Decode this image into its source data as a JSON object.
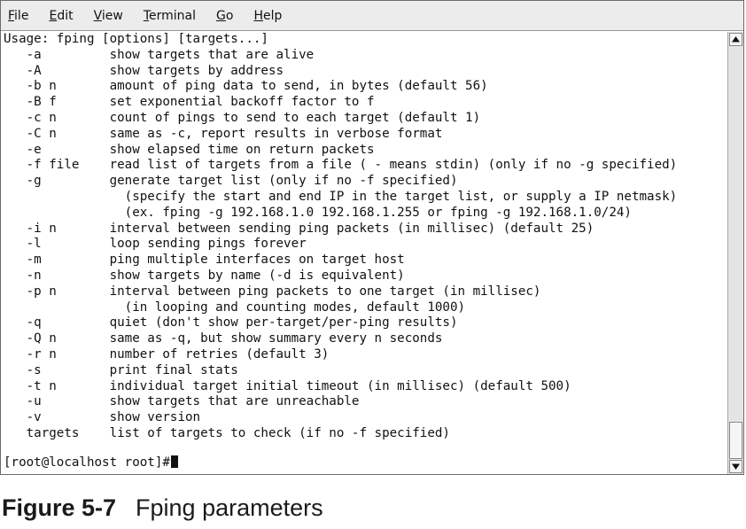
{
  "menubar": {
    "items": [
      {
        "mnemonic": "F",
        "rest": "ile"
      },
      {
        "mnemonic": "E",
        "rest": "dit"
      },
      {
        "mnemonic": "V",
        "rest": "iew"
      },
      {
        "mnemonic": "T",
        "rest": "erminal"
      },
      {
        "mnemonic": "G",
        "rest": "o"
      },
      {
        "mnemonic": "H",
        "rest": "elp"
      }
    ]
  },
  "terminal": {
    "lines": [
      "Usage: fping [options] [targets...]",
      "   -a         show targets that are alive",
      "   -A         show targets by address",
      "   -b n       amount of ping data to send, in bytes (default 56)",
      "   -B f       set exponential backoff factor to f",
      "   -c n       count of pings to send to each target (default 1)",
      "   -C n       same as -c, report results in verbose format",
      "   -e         show elapsed time on return packets",
      "   -f file    read list of targets from a file ( - means stdin) (only if no -g specified)",
      "   -g         generate target list (only if no -f specified)",
      "                (specify the start and end IP in the target list, or supply a IP netmask)",
      "                (ex. fping -g 192.168.1.0 192.168.1.255 or fping -g 192.168.1.0/24)",
      "   -i n       interval between sending ping packets (in millisec) (default 25)",
      "   -l         loop sending pings forever",
      "   -m         ping multiple interfaces on target host",
      "   -n         show targets by name (-d is equivalent)",
      "   -p n       interval between ping packets to one target (in millisec)",
      "                (in looping and counting modes, default 1000)",
      "   -q         quiet (don't show per-target/per-ping results)",
      "   -Q n       same as -q, but show summary every n seconds",
      "   -r n       number of retries (default 3)",
      "   -s         print final stats",
      "   -t n       individual target initial timeout (in millisec) (default 500)",
      "   -u         show targets that are unreachable",
      "   -v         show version",
      "   targets    list of targets to check (if no -f specified)"
    ],
    "prompt": "[root@localhost root]#"
  },
  "caption": {
    "figure_number": "Figure 5-7",
    "title": "Fping parameters"
  }
}
